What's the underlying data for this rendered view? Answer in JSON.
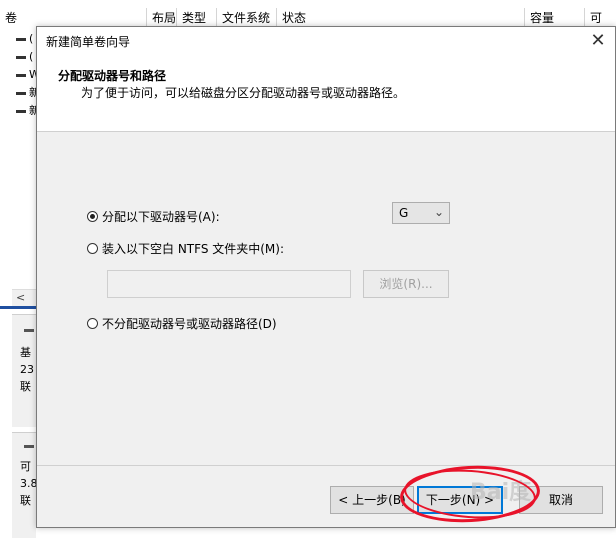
{
  "background": {
    "columns": [
      "卷",
      "布局",
      "类型",
      "文件系统",
      "状态",
      "容量",
      "可"
    ],
    "volume_rows": [
      "(",
      "(",
      "W",
      "新",
      "新"
    ],
    "scroll_left": "<",
    "disk0_lines": [
      "基",
      "23",
      "联"
    ],
    "disk1_lines": [
      "可",
      "3.8",
      "联"
    ]
  },
  "dialog": {
    "title": "新建简单卷向导",
    "close": "✕",
    "header_title": "分配驱动器号和路径",
    "header_subtitle": "为了便于访问，可以给磁盘分区分配驱动器号或驱动器路径。",
    "option_assign_letter": "分配以下驱动器号(A):",
    "option_mount_folder": "装入以下空白 NTFS 文件夹中(M):",
    "option_no_letter": "不分配驱动器号或驱动器路径(D)",
    "drive_letter": "G",
    "browse_button": "浏览(R)...",
    "back_button": "< 上一步(B)",
    "next_button": "下一步(N) >",
    "cancel_button": "取消",
    "selected_option": "assign_letter"
  },
  "annotation": {
    "watermark": "Bai度",
    "circle_color": "#e8132a"
  }
}
